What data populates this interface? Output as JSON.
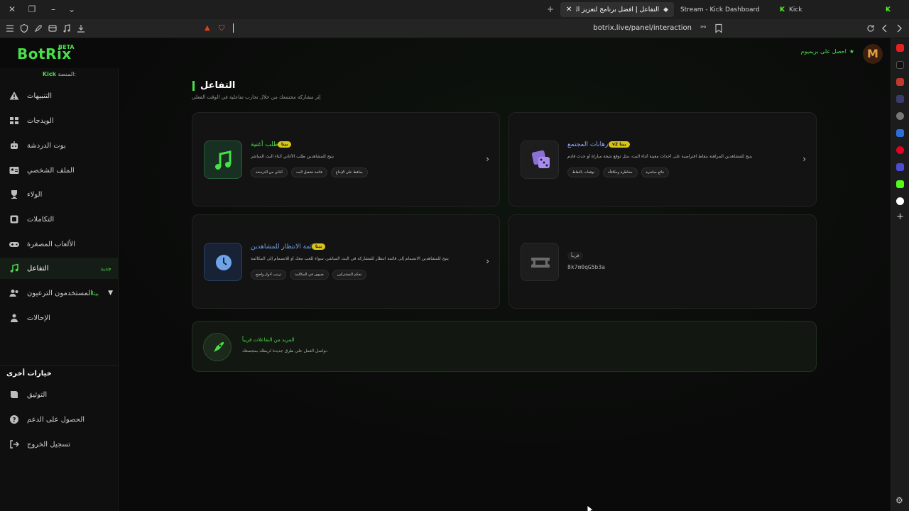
{
  "browser": {
    "tabs": [
      {
        "label": "التفاعل | أفضل برنامج لتعزيز البث",
        "active": true
      },
      {
        "label": "Stream - Kick Dashboard",
        "active": false
      },
      {
        "label": "Kick",
        "active": false
      }
    ],
    "url": "botrix.live/panel/interaction"
  },
  "header": {
    "logo": "BotRix",
    "logo_badge": "BETA",
    "premium_label": "احصل على بريميوم",
    "avatar_letter": "M"
  },
  "sidebar": {
    "platform_label": "المنصة:",
    "platform_name": "Kick",
    "items": [
      {
        "label": "التنبيهات",
        "icon": "warning-icon"
      },
      {
        "label": "الويدجات",
        "icon": "widgets-icon"
      },
      {
        "label": "بوت الدردشة",
        "icon": "robot-icon"
      },
      {
        "label": "الملف الشخصي",
        "icon": "id-card-icon"
      },
      {
        "label": "الولاء",
        "icon": "trophy-icon"
      },
      {
        "label": "التكاملات",
        "icon": "integrations-icon"
      },
      {
        "label": "الألعاب المصغرة",
        "icon": "gamepad-icon"
      },
      {
        "label": "التفاعل",
        "icon": "music-icon",
        "badge": "جديد",
        "active": true
      },
      {
        "label": "المستخدمون الترعيون",
        "icon": "users-icon",
        "badge": "بيتا"
      },
      {
        "label": "الإحالات",
        "icon": "referral-icon"
      }
    ],
    "other_heading": "خيارات أخرى",
    "other_items": [
      {
        "label": "التوثيق",
        "icon": "docs-icon"
      },
      {
        "label": "الحصول على الدعم",
        "icon": "help-icon"
      },
      {
        "label": "تسجيل الخروج",
        "icon": "logout-icon"
      }
    ]
  },
  "main": {
    "title": "التفاعل",
    "subtitle": "إثر مشاركة مجتمعك من خلال تجارب تفاعلية في الوقت الفعلي",
    "cards": [
      {
        "title": "رهانات المجتمع",
        "badge": "v2 بيتا",
        "desc": "يتيح للمشاهدين المراهنة بنقاط افتراضية على أحداث معينة أثناء البث، مثل توقع نتيجة مباراة أو حدث قادم",
        "tags": [
          "نتائج مباشرة",
          "مخاطرة ومكافأة",
          "توقعات بالنقاط"
        ],
        "icon": "dice-icon"
      },
      {
        "title": "طلب أغنية",
        "badge": "بيتا",
        "desc": "يتيح للمشاهدين طلب الأغاني أثناء البث المباشر",
        "tags": [
          "يحافظ على الإبداع",
          "قائمة تشغيل البث",
          "أغاني من الدردشة"
        ],
        "icon": "music-note-icon"
      },
      {
        "status": "قريباً",
        "code": "8k7m0qG5b3a",
        "icon": "ticket-icon"
      },
      {
        "title": "قائمة الانتظار للمشاهدين",
        "badge": "بيتا",
        "desc": "يتيح للمشاهدين الانضمام إلى قائمة انتظار للمشاركة في البث المباشر، سواء للعب معك أو للانضمام إلى المكالمة",
        "tags": [
          "تحكم المشتركين",
          "ضيوف في المكالمة",
          "ترتيب أدوار واضح"
        ],
        "icon": "clock-icon"
      }
    ],
    "more": {
      "title": "المزيد من التفاعلات قريباً",
      "desc": "نواصل العمل على طرق جديدة لربطك بمجتمعك."
    }
  }
}
